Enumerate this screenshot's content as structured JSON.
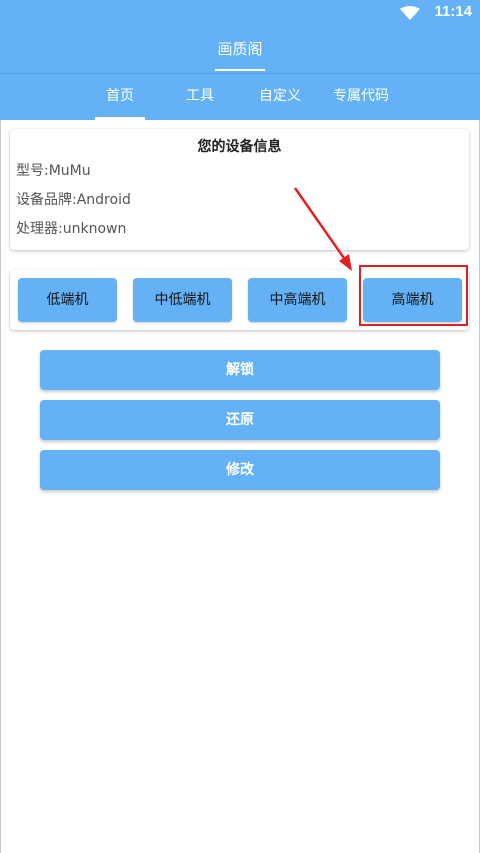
{
  "status_bar": {
    "time": "11:14",
    "wifi_icon": "wifi-icon"
  },
  "app_bar": {
    "title": "画质阁"
  },
  "tabs": [
    {
      "label": "首页",
      "active": true
    },
    {
      "label": "工具",
      "active": false
    },
    {
      "label": "自定义",
      "active": false
    },
    {
      "label": "专属代码",
      "active": false
    }
  ],
  "device_info": {
    "title": "您的设备信息",
    "model": "型号:MuMu",
    "brand": "设备品牌:Android",
    "processor": "处理器:unknown"
  },
  "levels": [
    {
      "label": "低端机"
    },
    {
      "label": "中低端机"
    },
    {
      "label": "中高端机"
    },
    {
      "label": "高端机",
      "highlighted": true
    }
  ],
  "actions": {
    "unlock": "解锁",
    "restore": "还原",
    "modify": "修改"
  },
  "colors": {
    "primary": "#64b2f5",
    "annotation": "#e12020"
  }
}
